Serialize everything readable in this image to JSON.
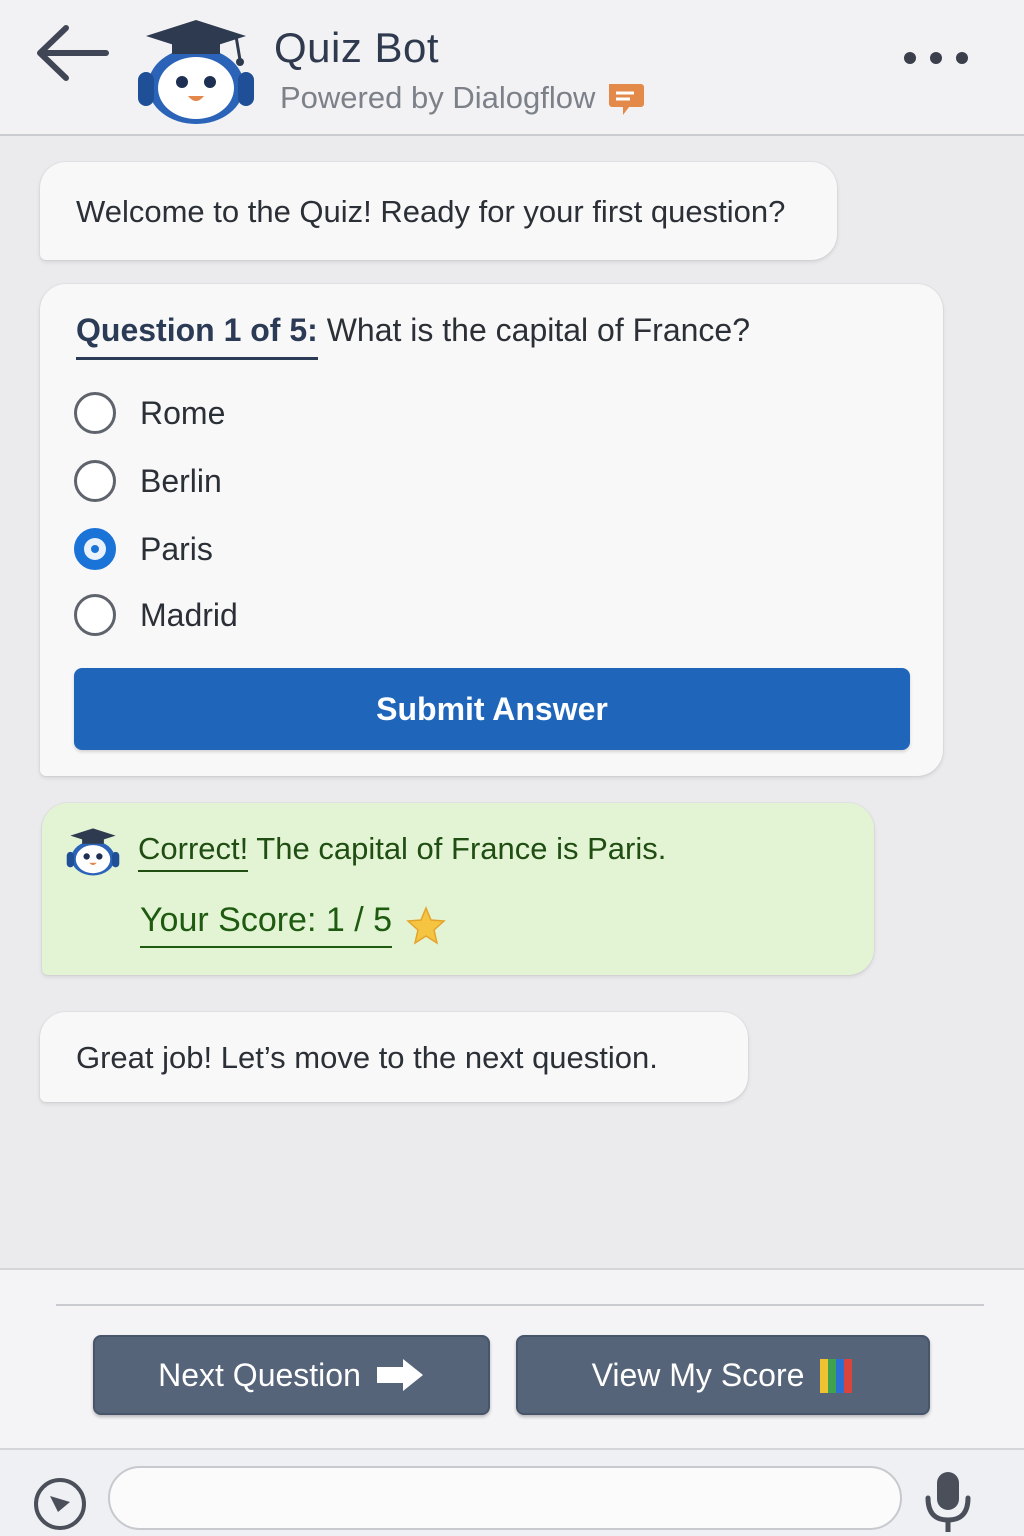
{
  "header": {
    "title": "Quiz Bot",
    "subtitle": "Powered by Dialogflow"
  },
  "messages": {
    "welcome": "Welcome to the Quiz! Ready for your first question?",
    "question": {
      "label": "Question 1 of 5:",
      "text": " What is the capital of France?",
      "options": [
        "Rome",
        "Berlin",
        "Paris",
        "Madrid"
      ],
      "selected": "Paris",
      "submit_label": "Submit Answer"
    },
    "feedback": {
      "correct_word": "Correct!",
      "correct_rest": " The capital of France is Paris.",
      "score_text": "Your Score: 1 / 5"
    },
    "encouragement": "Great job! Let’s move to the next question."
  },
  "actions": {
    "next_label": "Next Question",
    "score_label": "View My Score"
  },
  "input": {
    "value": "",
    "placeholder": ""
  },
  "icons": {
    "back": "back-arrow-icon",
    "more": "more-dots-icon",
    "brand": "dialogflow-chat-icon",
    "star": "star-icon",
    "arrow": "right-arrow-icon",
    "chart": "bar-chart-icon",
    "attach": "attach-icon",
    "mic": "microphone-icon"
  },
  "colors": {
    "primary": "#1f66bb",
    "success_bg": "#e3f4d4",
    "action_btn": "#566479",
    "brand_orange": "#e38a4a"
  }
}
